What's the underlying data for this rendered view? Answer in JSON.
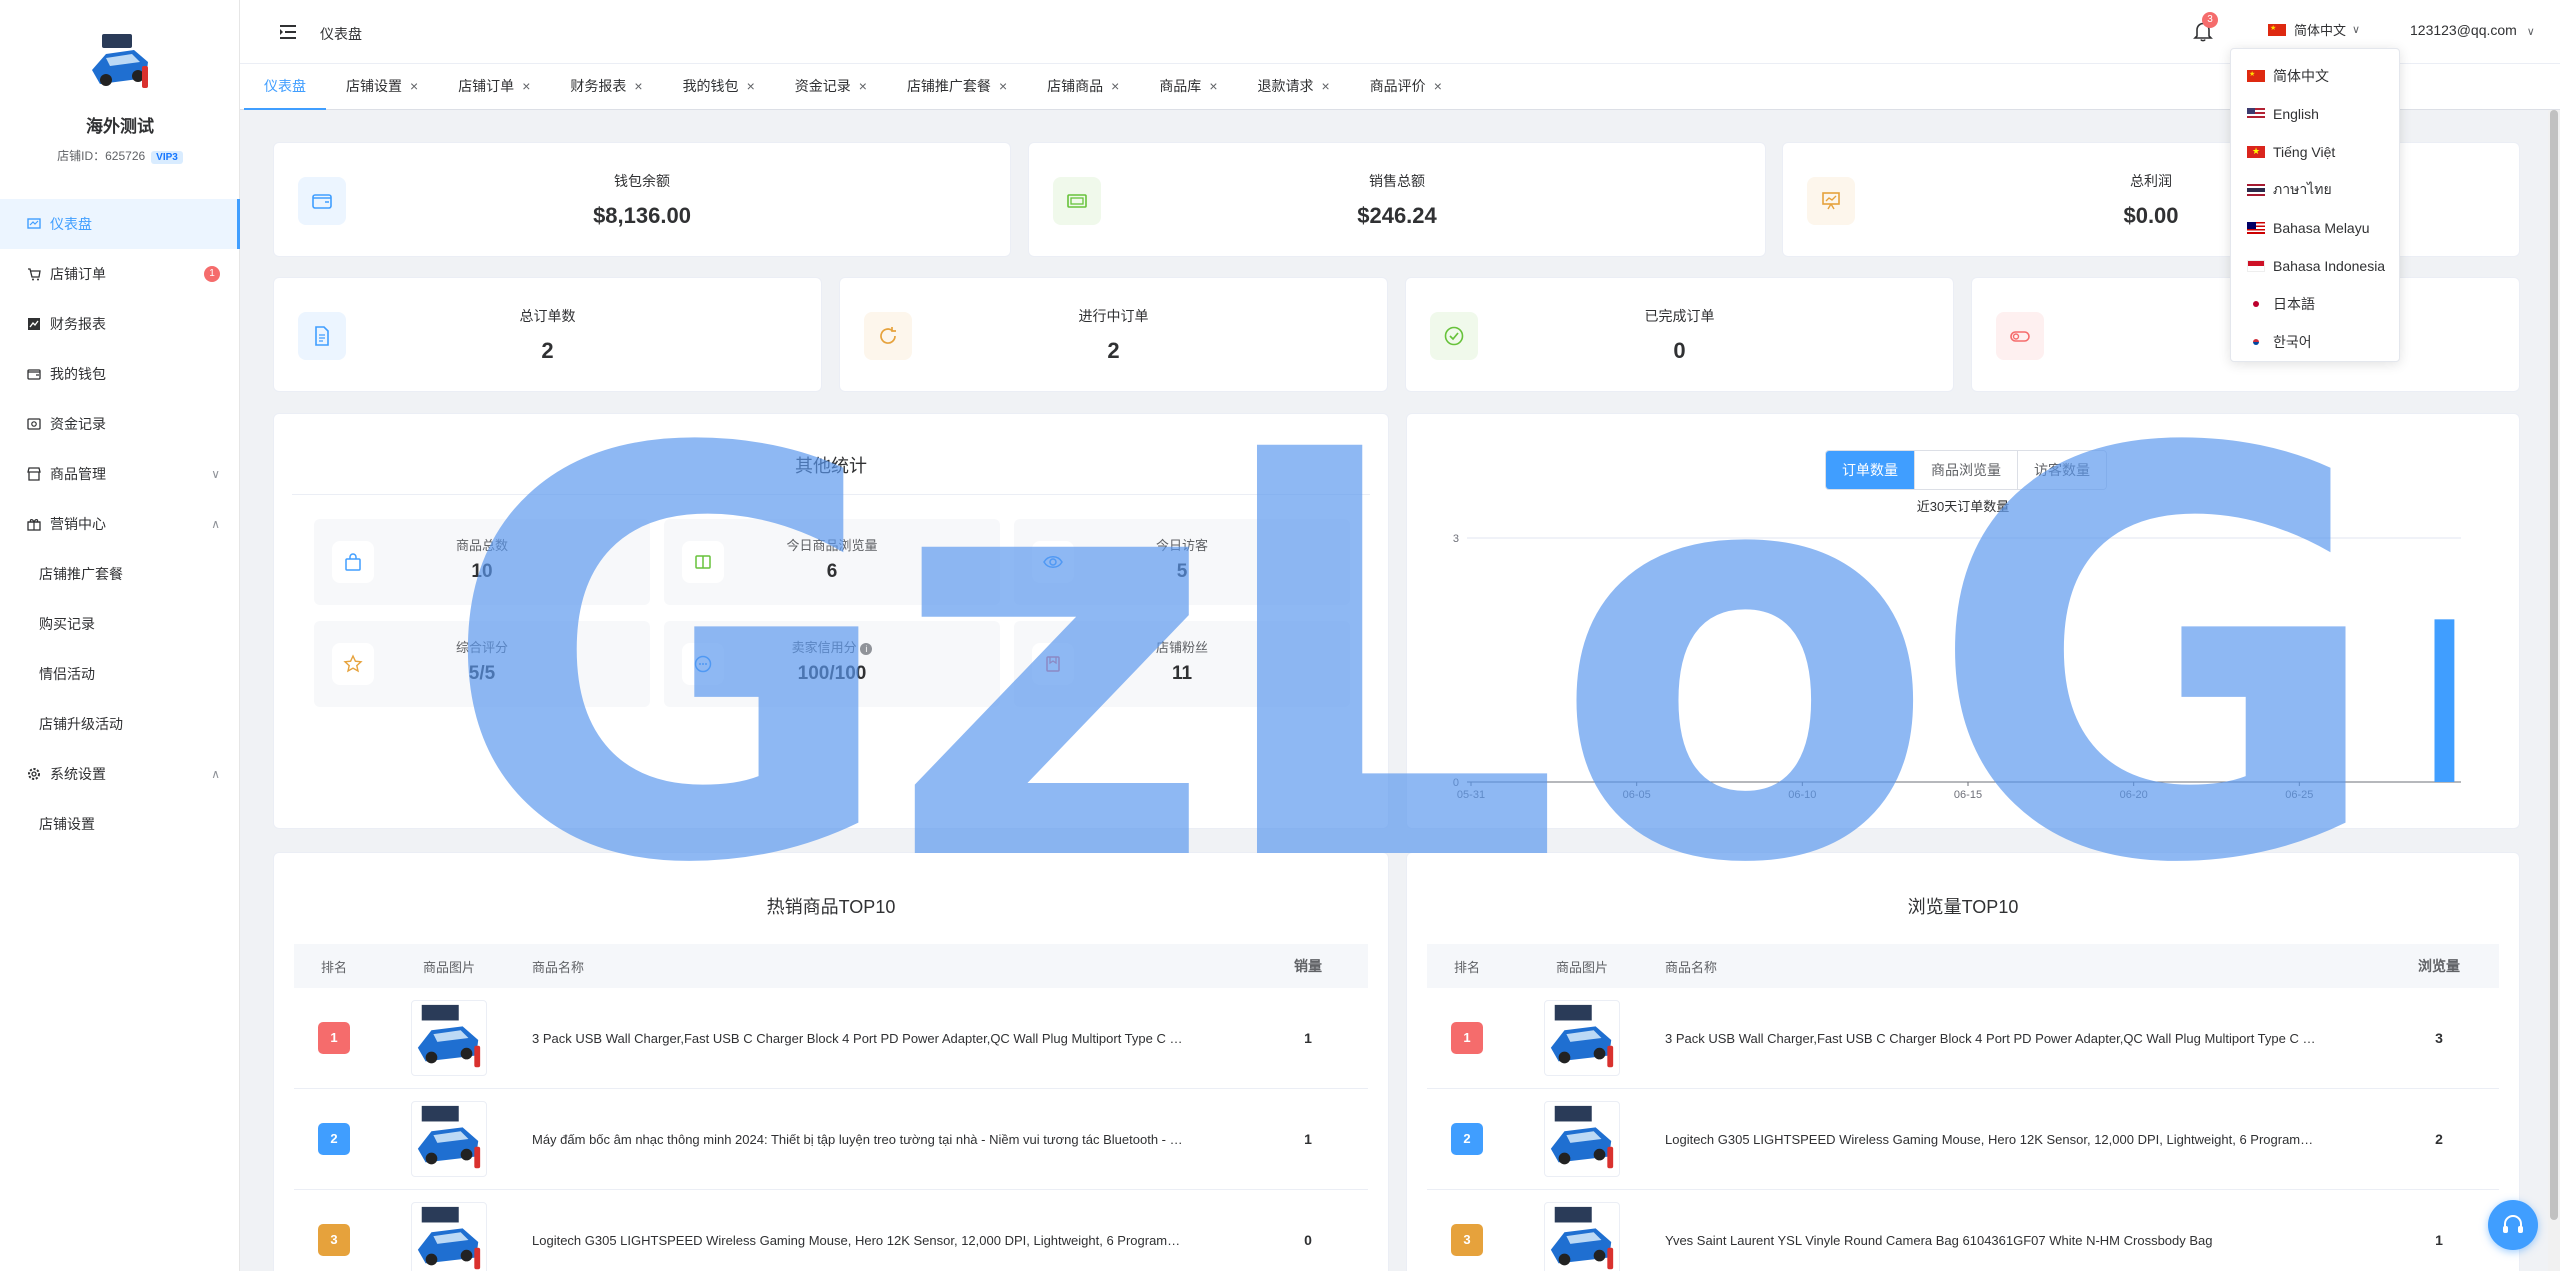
{
  "shop": {
    "name": "海外测试",
    "id_text": "店铺ID：625726",
    "vip": "VIP3"
  },
  "sidebar": {
    "items": [
      {
        "label": "仪表盘",
        "icon": "dashboard-icon"
      },
      {
        "label": "店铺订单",
        "icon": "cart-icon",
        "badge": "1"
      },
      {
        "label": "财务报表",
        "icon": "report-icon"
      },
      {
        "label": "我的钱包",
        "icon": "wallet-icon"
      },
      {
        "label": "资金记录",
        "icon": "money-record-icon"
      },
      {
        "label": "商品管理",
        "icon": "shop-icon"
      },
      {
        "label": "营销中心",
        "icon": "gift-icon"
      },
      {
        "label": "系统设置",
        "icon": "gear-icon"
      }
    ],
    "marketing_sub": [
      "店铺推广套餐",
      "购买记录",
      "情侣活动",
      "店铺升级活动"
    ],
    "system_sub": [
      "店铺设置"
    ]
  },
  "header": {
    "breadcrumb": "仪表盘",
    "notification_count": "3",
    "language": "简体中文",
    "user_email": "123123@qq.com"
  },
  "tabs": [
    "仪表盘",
    "店铺设置",
    "店铺订单",
    "财务报表",
    "我的钱包",
    "资金记录",
    "店铺推广套餐",
    "店铺商品",
    "商品库",
    "退款请求",
    "商品评价"
  ],
  "stats_top": [
    {
      "label": "钱包余额",
      "value": "$8,136.00"
    },
    {
      "label": "销售总额",
      "value": "$246.24"
    },
    {
      "label": "总利润",
      "value": "$0.00"
    }
  ],
  "stats_mid": [
    {
      "label": "总订单数",
      "value": "2"
    },
    {
      "label": "进行中订单",
      "value": "2"
    },
    {
      "label": "已完成订单",
      "value": "0"
    }
  ],
  "other_stats": {
    "title": "其他统计",
    "items": [
      {
        "label": "商品总数",
        "value": "10"
      },
      {
        "label": "今日商品浏览量",
        "value": "6"
      },
      {
        "label": "今日访客",
        "value": "5"
      },
      {
        "label": "综合评分",
        "value": "5/5"
      },
      {
        "label": "卖家信用分",
        "value": "100/100"
      },
      {
        "label": "店铺粉丝",
        "value": "11"
      }
    ]
  },
  "chart_tabs": [
    "订单数量",
    "商品浏览量",
    "访客数量"
  ],
  "chart_data": {
    "type": "bar",
    "title": "近30天订单数量",
    "x": [
      "05-31",
      "06-01",
      "06-02",
      "06-03",
      "06-04",
      "06-05",
      "06-06",
      "06-07",
      "06-08",
      "06-09",
      "06-10",
      "06-11",
      "06-12",
      "06-13",
      "06-14",
      "06-15",
      "06-16",
      "06-17",
      "06-18",
      "06-19",
      "06-20",
      "06-21",
      "06-22",
      "06-23",
      "06-24",
      "06-25",
      "06-26",
      "06-27",
      "06-28",
      "06-29"
    ],
    "x_tick_labels": [
      "05-31",
      "06-05",
      "06-10",
      "06-15",
      "06-20",
      "06-25"
    ],
    "values": [
      0,
      0,
      0,
      0,
      0,
      0,
      0,
      0,
      0,
      0,
      0,
      0,
      0,
      0,
      0,
      0,
      0,
      0,
      0,
      0,
      0,
      0,
      0,
      0,
      0,
      0,
      0,
      0,
      0,
      2
    ],
    "ylim": [
      0,
      3
    ],
    "y_ticks": [
      "0",
      "3"
    ],
    "color": "#409eff"
  },
  "hot_top10": {
    "title": "热销商品TOP10",
    "columns": [
      "排名",
      "商品图片",
      "商品名称",
      "销量"
    ],
    "rows": [
      {
        "rank": "1",
        "name": "3 Pack USB Wall Charger,Fast USB C Charger Block 4 Port PD Power Adapter,QC Wall Plug Multiport Type C …",
        "num": "1"
      },
      {
        "rank": "2",
        "name": "Máy đấm bốc âm nhạc thông minh 2024: Thiết bị tập luyện treo tường tại nhà - Niềm vui tương tác Bluetooth - …",
        "num": "1"
      },
      {
        "rank": "3",
        "name": "Logitech G305 LIGHTSPEED Wireless Gaming Mouse, Hero 12K Sensor, 12,000 DPI, Lightweight, 6 Program…",
        "num": "0"
      }
    ]
  },
  "view_top10": {
    "title": "浏览量TOP10",
    "columns": [
      "排名",
      "商品图片",
      "商品名称",
      "浏览量"
    ],
    "rows": [
      {
        "rank": "1",
        "name": "3 Pack USB Wall Charger,Fast USB C Charger Block 4 Port PD Power Adapter,QC Wall Plug Multiport Type C …",
        "num": "3"
      },
      {
        "rank": "2",
        "name": "Logitech G305 LIGHTSPEED Wireless Gaming Mouse, Hero 12K Sensor, 12,000 DPI, Lightweight, 6 Program…",
        "num": "2"
      },
      {
        "rank": "3",
        "name": "Yves Saint Laurent YSL Vinyle Round Camera Bag 6104361GF07 White N-HM Crossbody Bag",
        "num": "1"
      }
    ]
  },
  "languages": [
    "简体中文",
    "English",
    "Tiếng Việt",
    "ภาษาไทย",
    "Bahasa Melayu",
    "Bahasa Indonesia",
    "日本語",
    "한국어"
  ],
  "watermark": "GzLoG",
  "colors": {
    "accent": "#409eff",
    "rank1": "#f56c6c",
    "rank2": "#409eff",
    "rank3": "#e6a23c"
  }
}
